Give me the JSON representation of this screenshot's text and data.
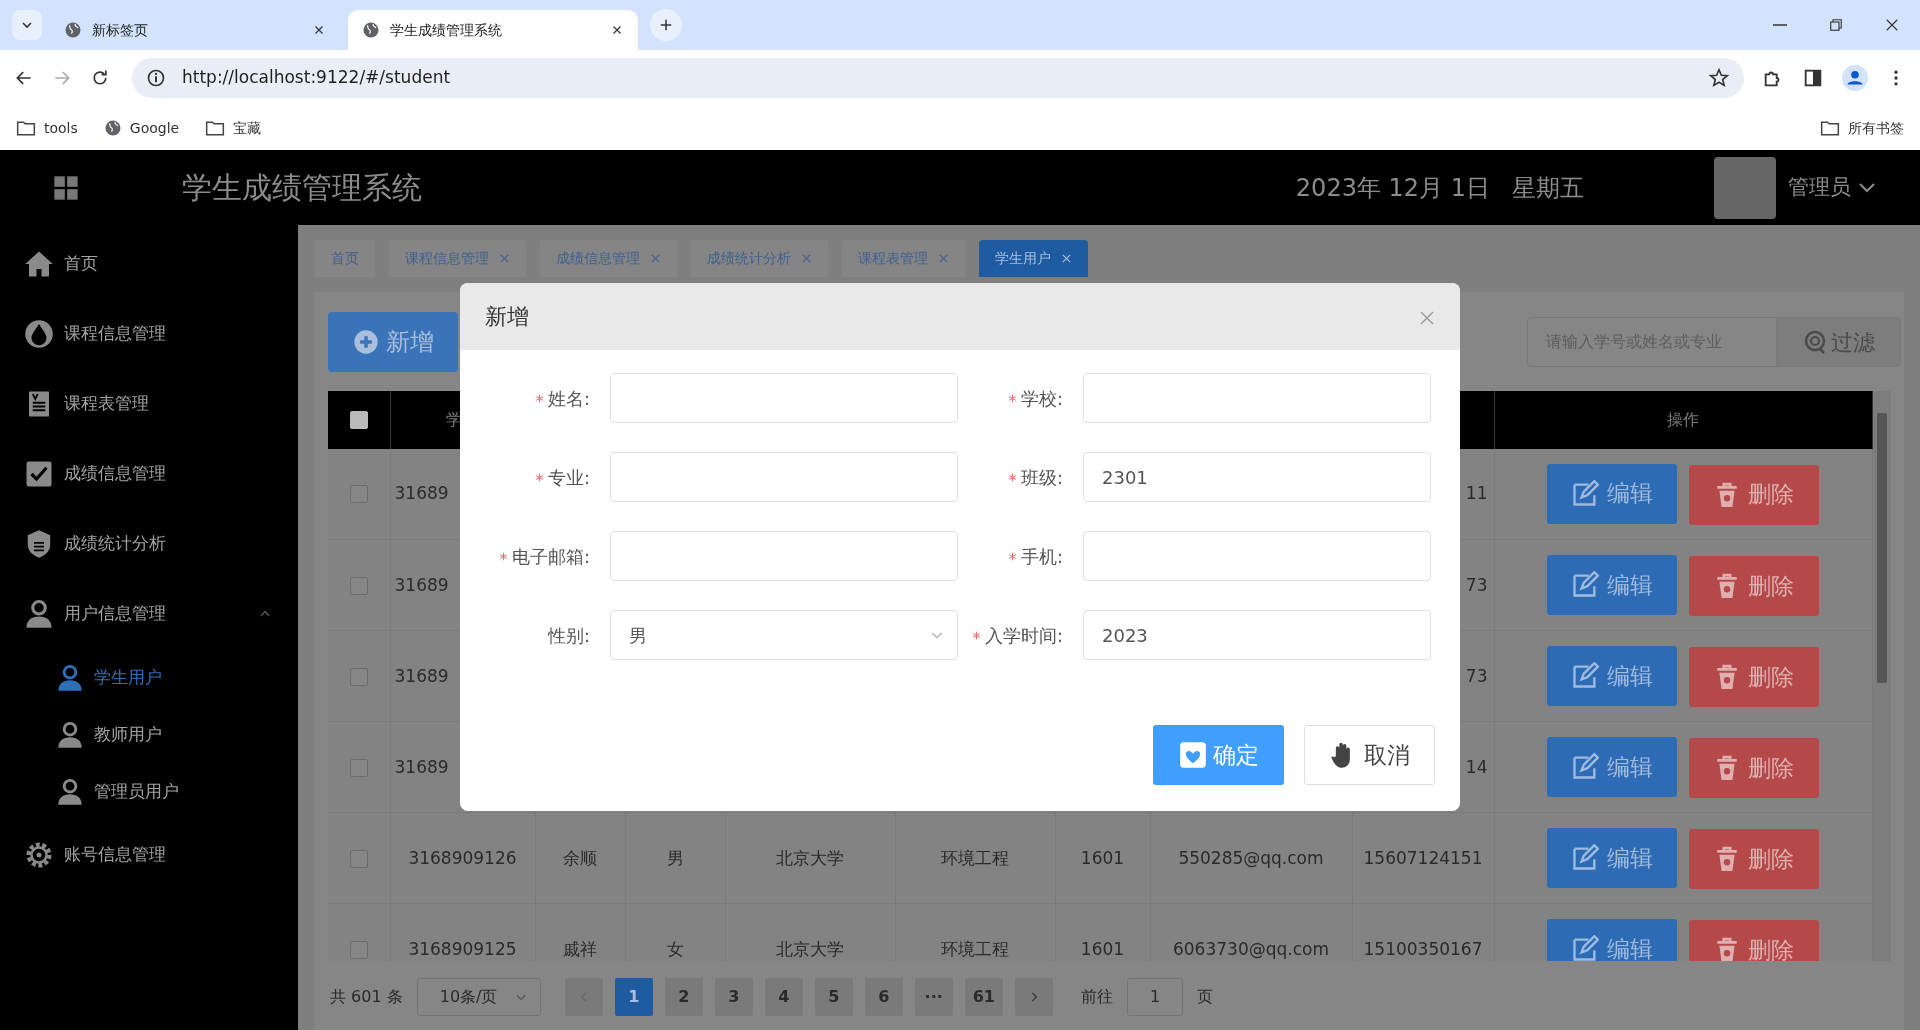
{
  "browser": {
    "tabs": [
      {
        "title": "新标签页",
        "selected": false
      },
      {
        "title": "学生成绩管理系统",
        "selected": true
      }
    ],
    "url": "http://localhost:9122/#/student",
    "bookmarks": [
      {
        "label": "tools",
        "kind": "folder"
      },
      {
        "label": "Google",
        "kind": "site"
      },
      {
        "label": "宝藏",
        "kind": "folder"
      }
    ],
    "all_bookmarks": "所有书签"
  },
  "app": {
    "title": "学生成绩管理系统",
    "date": "2023年 12月 1日",
    "weekday": "星期五",
    "user": "管理员"
  },
  "sidebar": {
    "items": [
      {
        "label": "首页",
        "selected": false
      },
      {
        "label": "课程信息管理",
        "selected": false
      },
      {
        "label": "课程表管理",
        "selected": false
      },
      {
        "label": "成绩信息管理",
        "selected": false
      },
      {
        "label": "成绩统计分析",
        "selected": false
      },
      {
        "label": "用户信息管理",
        "selected": false,
        "expanded": true,
        "children": [
          {
            "label": "学生用户",
            "selected": true
          },
          {
            "label": "教师用户",
            "selected": false
          },
          {
            "label": "管理员用户",
            "selected": false
          }
        ]
      },
      {
        "label": "账号信息管理",
        "selected": false
      }
    ]
  },
  "tabs": [
    {
      "label": "首页",
      "selected": false,
      "closable": false
    },
    {
      "label": "课程信息管理",
      "selected": false,
      "closable": true
    },
    {
      "label": "成绩信息管理",
      "selected": false,
      "closable": true
    },
    {
      "label": "成绩统计分析",
      "selected": false,
      "closable": true
    },
    {
      "label": "课程表管理",
      "selected": false,
      "closable": true
    },
    {
      "label": "学生用户",
      "selected": true,
      "closable": true
    }
  ],
  "toolbar": {
    "add_button": "新增",
    "search": {
      "placeholder": "请输入学号或姓名或专业"
    },
    "filter_button": "过滤"
  },
  "table": {
    "header": {
      "checked": false,
      "student_id": "学",
      "actions": "操作"
    },
    "rows": [
      {
        "checked": false,
        "student_id": "31689",
        "phone": "11",
        "edit": "编辑",
        "delete": "删除"
      },
      {
        "checked": false,
        "student_id": "31689",
        "phone": "73",
        "edit": "编辑",
        "delete": "删除"
      },
      {
        "checked": false,
        "student_id": "31689",
        "phone": "73",
        "edit": "编辑",
        "delete": "删除"
      },
      {
        "checked": false,
        "student_id": "31689",
        "phone": "14",
        "edit": "编辑",
        "delete": "删除"
      },
      {
        "checked": false,
        "student_id": "3168909126",
        "name": "余顺",
        "gender": "男",
        "school": "北京大学",
        "major": "环境工程",
        "class": "1601",
        "email": "550285@qq.com",
        "phone": "15607124151",
        "edit": "编辑",
        "delete": "删除"
      },
      {
        "checked": false,
        "student_id": "3168909125",
        "name": "戚祥",
        "gender": "女",
        "school": "北京大学",
        "major": "环境工程",
        "class": "1601",
        "email": "6063730@qq.com",
        "phone": "15100350167",
        "edit": "编辑",
        "delete": "删除"
      }
    ]
  },
  "pagination": {
    "total": "共 601 条",
    "page_size": "10条/页",
    "pages": [
      {
        "label": "1",
        "selected": true
      },
      {
        "label": "2",
        "selected": false
      },
      {
        "label": "3",
        "selected": false
      },
      {
        "label": "4",
        "selected": false
      },
      {
        "label": "5",
        "selected": false
      },
      {
        "label": "6",
        "selected": false
      },
      {
        "label": "···",
        "selected": false
      },
      {
        "label": "61",
        "selected": false
      }
    ],
    "goto_label": "前往",
    "goto_value": "1",
    "goto_suffix": "页"
  },
  "dialog": {
    "title": "新增",
    "fields": [
      {
        "label": "姓名:",
        "required": true,
        "kind": "text"
      },
      {
        "label": "学校:",
        "required": true,
        "kind": "text"
      },
      {
        "label": "专业:",
        "required": true,
        "kind": "text"
      },
      {
        "label": "班级:",
        "required": true,
        "kind": "text",
        "value": "2301"
      },
      {
        "label": "电子邮箱:",
        "required": true,
        "kind": "text"
      },
      {
        "label": "手机:",
        "required": true,
        "kind": "text"
      },
      {
        "label": "性别:",
        "required": false,
        "kind": "select",
        "value": "男"
      },
      {
        "label": "入学时间:",
        "required": true,
        "kind": "text",
        "value": "2023"
      }
    ],
    "buttons": [
      {
        "label": "确定",
        "kind": "primary"
      },
      {
        "label": "取消",
        "kind": "default"
      }
    ]
  }
}
